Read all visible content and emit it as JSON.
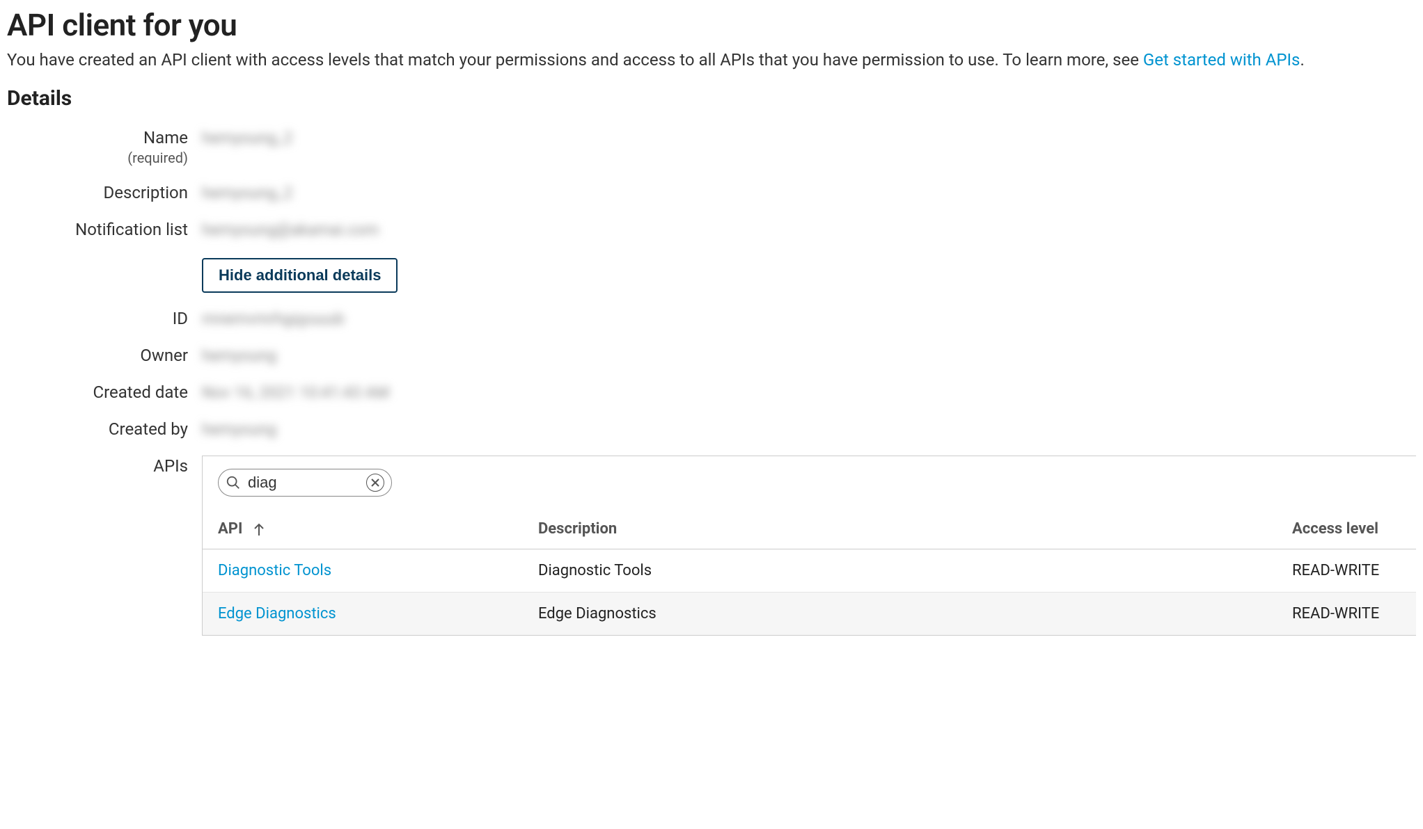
{
  "header": {
    "title": "API client for you",
    "subtitle_pre": "You have created an API client with access levels that match your permissions and access to all APIs that you have permission to use. To learn more, see ",
    "subtitle_link": "Get started with APIs",
    "subtitle_post": "."
  },
  "details": {
    "heading": "Details",
    "name_label": "Name",
    "name_required": "(required)",
    "name_value": "hemyoung_2",
    "description_label": "Description",
    "description_value": "hemyoung_2",
    "notification_label": "Notification list",
    "notification_value": "hemyoung@akamai.com",
    "hide_button": "Hide additional details",
    "id_label": "ID",
    "id_value": "mnemvmrhgqyuuub",
    "owner_label": "Owner",
    "owner_value": "hemyoung",
    "created_date_label": "Created date",
    "created_date_value": "Nov 16, 2021 10:41:43 AM",
    "created_by_label": "Created by",
    "created_by_value": "hemyoung",
    "apis_label": "APIs"
  },
  "apis": {
    "search_value": "diag",
    "columns": {
      "api": "API",
      "description": "Description",
      "access_level": "Access level"
    },
    "rows": [
      {
        "api": "Diagnostic Tools",
        "description": "Diagnostic Tools",
        "access_level": "READ-WRITE"
      },
      {
        "api": "Edge Diagnostics",
        "description": "Edge Diagnostics",
        "access_level": "READ-WRITE"
      }
    ]
  }
}
